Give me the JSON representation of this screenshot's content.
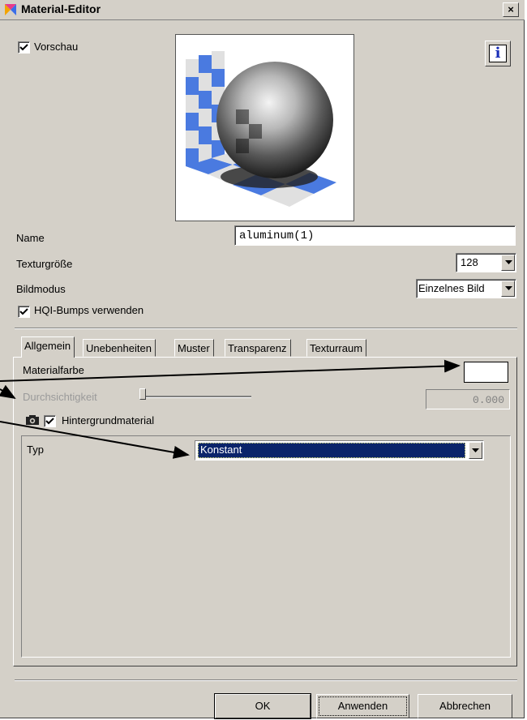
{
  "window": {
    "title": "Material-Editor",
    "close_label": "×"
  },
  "preview": {
    "checkbox_label": "Vorschau",
    "checked": true,
    "info_label": "i"
  },
  "fields": {
    "name_label": "Name",
    "name_value": "aluminum(1)",
    "texture_size_label": "Texturgröße",
    "texture_size_value": "128",
    "image_mode_label": "Bildmodus",
    "image_mode_value": "Einzelnes Bild",
    "hqi_label": "HQI-Bumps verwenden"
  },
  "tabs": [
    {
      "label": "Allgemein",
      "active": true
    },
    {
      "label": "Unebenheiten"
    },
    {
      "label": "Muster"
    },
    {
      "label": "Transparenz"
    },
    {
      "label": "Texturraum"
    }
  ],
  "general": {
    "material_color_label": "Materialfarbe",
    "material_color": "#ffffff",
    "opacity_label": "Durchsichtigkeit",
    "opacity_value": "0.000",
    "opacity_level": 0.0,
    "background_material_label": "Hintergrundmaterial",
    "type_label": "Typ",
    "type_value": "Konstant"
  },
  "buttons": {
    "ok": "OK",
    "apply": "Anwenden",
    "cancel": "Abbrechen"
  },
  "colors": {
    "selection": "#0a246a",
    "face": "#d4d0c8"
  }
}
